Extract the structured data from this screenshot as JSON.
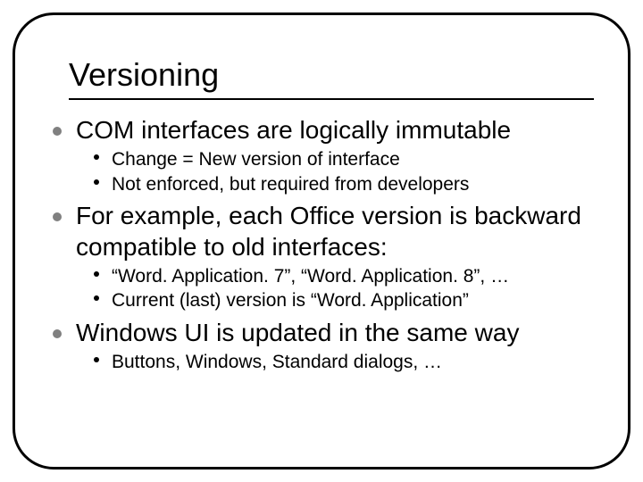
{
  "slide": {
    "title": "Versioning",
    "bullets": [
      {
        "text": "COM interfaces are logically immutable",
        "sub": [
          "Change = New version of interface",
          "Not enforced, but required from developers"
        ]
      },
      {
        "text": "For example, each Office version is backward compatible to old interfaces:",
        "sub": [
          "“Word. Application. 7”, “Word. Application. 8”, …",
          "Current (last) version is “Word. Application”"
        ]
      },
      {
        "text": "Windows UI is updated in the same way",
        "sub": [
          "Buttons, Windows, Standard dialogs, …"
        ]
      }
    ]
  }
}
